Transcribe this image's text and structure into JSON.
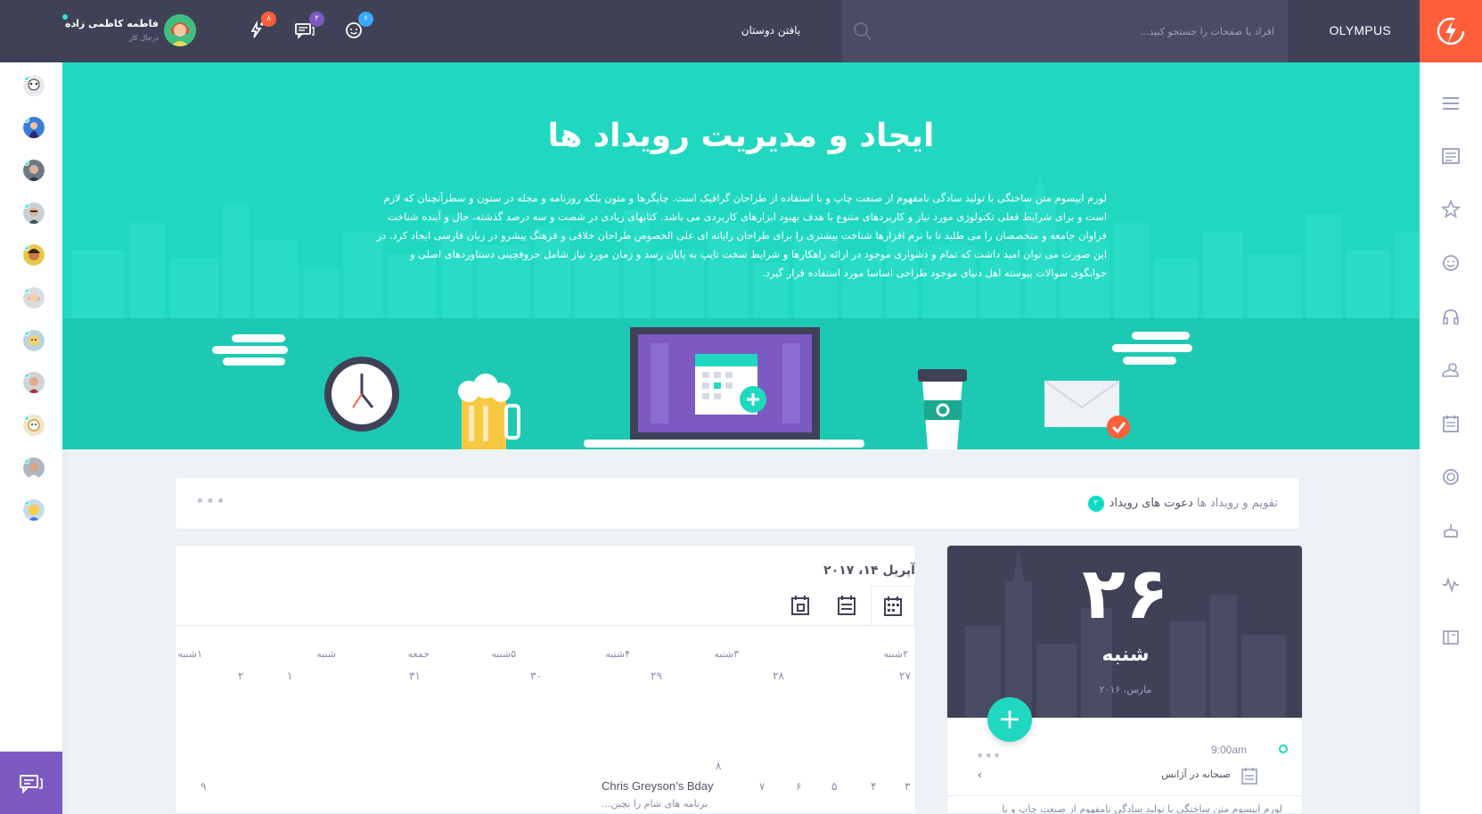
{
  "header": {
    "brand": "OLYMPUS",
    "search_placeholder": "افراد یا صفحات را جستجو کنید...",
    "find_friends": "یافتن دوستان",
    "badges": {
      "friend_requests": "۶",
      "messages": "۲",
      "notifications": "۸"
    },
    "user": {
      "name": "فاطمه کاظمی زاده",
      "status": "درحال کار"
    }
  },
  "hero": {
    "title": "ایجاد و مدیریت رویداد ها",
    "text": "لورم ایپسوم متن ساختگی با تولید سادگی نامفهوم از صنعت چاپ و با استفاده از طراحان گرافیک است. چاپگرها و متون بلکه روزنامه و مجله در ستون و سطرآنچنان که لازم است و برای شرایط فعلی تکنولوژی مورد نیاز و کاربردهای متنوع با هدف بهبود ابزارهای کاربردی می باشد. کتابهای زیادی در شصت و سه درصد گذشته، حال و آینده شناخت فراوان جامعه و متخصصان را می طلبد تا با نرم افزارها شناخت بیشتری را برای طراحان رایانه ای علی الخصوص طراحان خلاقی و فرهنگ پیشرو در زبان فارسی ایجاد کرد. در این صورت می توان امید داشت که تمام و دشواری موجود در ارائه راهکارها و شرایط سخت تایپ به پایان رسد و زمان مورد نیاز شامل حروفچینی دستاوردهای اصلی و جوابگوی سوالات پیوسته اهل دنیای موجود طراحی اساسا مورد استفاده قرار گیرد."
  },
  "tabs": {
    "calendar": "تقویم و رویداد ها",
    "invites": "دعوت های رویداد",
    "invites_count": "۲"
  },
  "calendar": {
    "date_label": "آپریل ۱۴، ۲۰۱۷",
    "week_days": [
      "۲شنبه",
      "۳شنبه",
      "۴شنبه",
      "۵شنبه",
      "جمعه",
      "شنبه",
      "۱شنبه"
    ],
    "row1": [
      "۲۷",
      "۲۸",
      "۲۹",
      "۳۰",
      "۳۱",
      "۱",
      "۲"
    ],
    "row2": [
      "۳",
      "۴",
      "۵",
      "۶",
      "۷",
      "۸",
      "۹"
    ],
    "event_title": "Chris Greyson’s Bday",
    "event_sub": "برنامه های شام را بچین..."
  },
  "date_card": {
    "day_number": "۲۶",
    "weekday": "شنبه",
    "month": "مارس، ۲۰۱۶",
    "event_time": "9:00am",
    "event_name": "صبحانه در آژانس",
    "event_desc": "لورم ایپسوم متن ساختگی با تولید سادگی نامفهوم از صنعت چاپ و با"
  },
  "colors": {
    "header": "#3f4257",
    "accent": "#ff5e3a",
    "hero": "#20d8c0",
    "purple": "#7c5ac2"
  }
}
